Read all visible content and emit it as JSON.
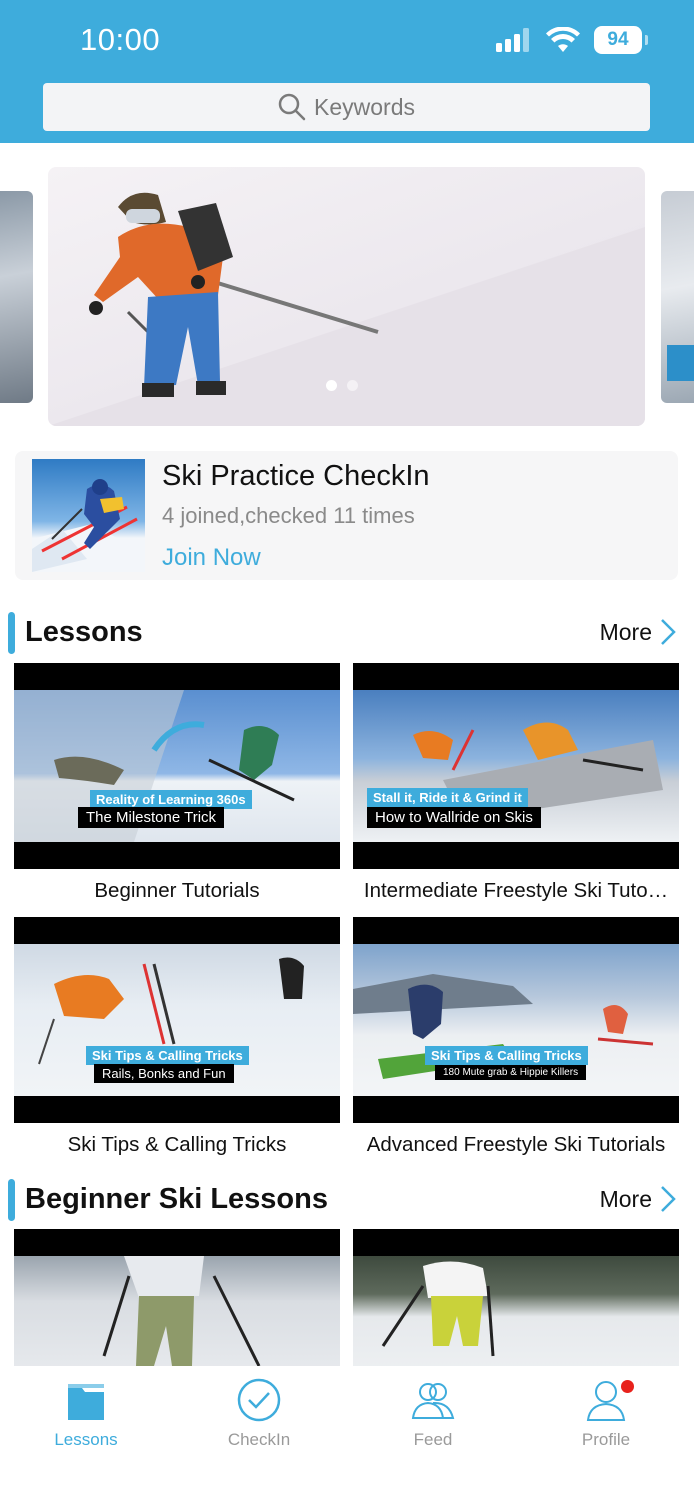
{
  "status_bar": {
    "time": "10:00",
    "battery": "94"
  },
  "search": {
    "placeholder": "Keywords"
  },
  "carousel": {
    "page_count": 2,
    "active_index": 0
  },
  "checkin": {
    "title": "Ski Practice CheckIn",
    "stats": "4 joined,checked 11 times",
    "action": "Join Now"
  },
  "sections": [
    {
      "title": "Lessons",
      "more": "More",
      "items": [
        {
          "title": "Beginner Tutorials",
          "caption_top": "Reality of Learning 360s",
          "caption_bottom": "The Milestone Trick"
        },
        {
          "title": "Intermediate Freestyle Ski Tuto…",
          "caption_top": "Stall it, Ride it & Grind it",
          "caption_bottom": "How to Wallride on Skis"
        },
        {
          "title": "Ski Tips & Calling Tricks",
          "caption_top": "Ski Tips & Calling Tricks",
          "caption_bottom": "Rails, Bonks and Fun"
        },
        {
          "title": "Advanced Freestyle Ski Tutorials",
          "caption_top": "Ski Tips & Calling Tricks",
          "caption_bottom": "180 Mute grab & Hippie Killers"
        }
      ]
    },
    {
      "title": "Beginner Ski Lessons",
      "more": "More"
    }
  ],
  "tabs": [
    {
      "label": "Lessons",
      "icon": "folder-icon",
      "active": true
    },
    {
      "label": "CheckIn",
      "icon": "check-circle-icon",
      "active": false
    },
    {
      "label": "Feed",
      "icon": "people-icon",
      "active": false
    },
    {
      "label": "Profile",
      "icon": "person-icon",
      "active": false,
      "badge": true
    }
  ],
  "colors": {
    "accent": "#3eacdc",
    "badge": "#e8221c",
    "muted": "#9a9a9a"
  }
}
